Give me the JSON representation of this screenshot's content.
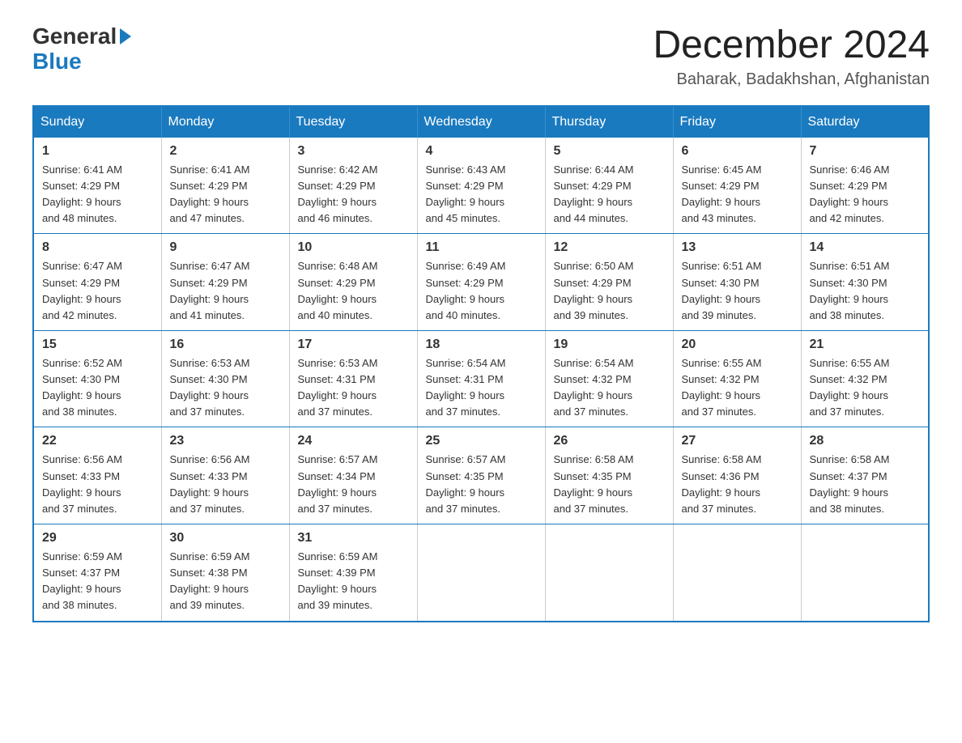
{
  "logo": {
    "general": "General",
    "blue": "Blue",
    "arrow": "▶"
  },
  "title": {
    "month_year": "December 2024",
    "location": "Baharak, Badakhshan, Afghanistan"
  },
  "days_of_week": [
    "Sunday",
    "Monday",
    "Tuesday",
    "Wednesday",
    "Thursday",
    "Friday",
    "Saturday"
  ],
  "weeks": [
    [
      {
        "day": "1",
        "sunrise": "6:41 AM",
        "sunset": "4:29 PM",
        "daylight": "9 hours and 48 minutes."
      },
      {
        "day": "2",
        "sunrise": "6:41 AM",
        "sunset": "4:29 PM",
        "daylight": "9 hours and 47 minutes."
      },
      {
        "day": "3",
        "sunrise": "6:42 AM",
        "sunset": "4:29 PM",
        "daylight": "9 hours and 46 minutes."
      },
      {
        "day": "4",
        "sunrise": "6:43 AM",
        "sunset": "4:29 PM",
        "daylight": "9 hours and 45 minutes."
      },
      {
        "day": "5",
        "sunrise": "6:44 AM",
        "sunset": "4:29 PM",
        "daylight": "9 hours and 44 minutes."
      },
      {
        "day": "6",
        "sunrise": "6:45 AM",
        "sunset": "4:29 PM",
        "daylight": "9 hours and 43 minutes."
      },
      {
        "day": "7",
        "sunrise": "6:46 AM",
        "sunset": "4:29 PM",
        "daylight": "9 hours and 42 minutes."
      }
    ],
    [
      {
        "day": "8",
        "sunrise": "6:47 AM",
        "sunset": "4:29 PM",
        "daylight": "9 hours and 42 minutes."
      },
      {
        "day": "9",
        "sunrise": "6:47 AM",
        "sunset": "4:29 PM",
        "daylight": "9 hours and 41 minutes."
      },
      {
        "day": "10",
        "sunrise": "6:48 AM",
        "sunset": "4:29 PM",
        "daylight": "9 hours and 40 minutes."
      },
      {
        "day": "11",
        "sunrise": "6:49 AM",
        "sunset": "4:29 PM",
        "daylight": "9 hours and 40 minutes."
      },
      {
        "day": "12",
        "sunrise": "6:50 AM",
        "sunset": "4:29 PM",
        "daylight": "9 hours and 39 minutes."
      },
      {
        "day": "13",
        "sunrise": "6:51 AM",
        "sunset": "4:30 PM",
        "daylight": "9 hours and 39 minutes."
      },
      {
        "day": "14",
        "sunrise": "6:51 AM",
        "sunset": "4:30 PM",
        "daylight": "9 hours and 38 minutes."
      }
    ],
    [
      {
        "day": "15",
        "sunrise": "6:52 AM",
        "sunset": "4:30 PM",
        "daylight": "9 hours and 38 minutes."
      },
      {
        "day": "16",
        "sunrise": "6:53 AM",
        "sunset": "4:30 PM",
        "daylight": "9 hours and 37 minutes."
      },
      {
        "day": "17",
        "sunrise": "6:53 AM",
        "sunset": "4:31 PM",
        "daylight": "9 hours and 37 minutes."
      },
      {
        "day": "18",
        "sunrise": "6:54 AM",
        "sunset": "4:31 PM",
        "daylight": "9 hours and 37 minutes."
      },
      {
        "day": "19",
        "sunrise": "6:54 AM",
        "sunset": "4:32 PM",
        "daylight": "9 hours and 37 minutes."
      },
      {
        "day": "20",
        "sunrise": "6:55 AM",
        "sunset": "4:32 PM",
        "daylight": "9 hours and 37 minutes."
      },
      {
        "day": "21",
        "sunrise": "6:55 AM",
        "sunset": "4:32 PM",
        "daylight": "9 hours and 37 minutes."
      }
    ],
    [
      {
        "day": "22",
        "sunrise": "6:56 AM",
        "sunset": "4:33 PM",
        "daylight": "9 hours and 37 minutes."
      },
      {
        "day": "23",
        "sunrise": "6:56 AM",
        "sunset": "4:33 PM",
        "daylight": "9 hours and 37 minutes."
      },
      {
        "day": "24",
        "sunrise": "6:57 AM",
        "sunset": "4:34 PM",
        "daylight": "9 hours and 37 minutes."
      },
      {
        "day": "25",
        "sunrise": "6:57 AM",
        "sunset": "4:35 PM",
        "daylight": "9 hours and 37 minutes."
      },
      {
        "day": "26",
        "sunrise": "6:58 AM",
        "sunset": "4:35 PM",
        "daylight": "9 hours and 37 minutes."
      },
      {
        "day": "27",
        "sunrise": "6:58 AM",
        "sunset": "4:36 PM",
        "daylight": "9 hours and 37 minutes."
      },
      {
        "day": "28",
        "sunrise": "6:58 AM",
        "sunset": "4:37 PM",
        "daylight": "9 hours and 38 minutes."
      }
    ],
    [
      {
        "day": "29",
        "sunrise": "6:59 AM",
        "sunset": "4:37 PM",
        "daylight": "9 hours and 38 minutes."
      },
      {
        "day": "30",
        "sunrise": "6:59 AM",
        "sunset": "4:38 PM",
        "daylight": "9 hours and 39 minutes."
      },
      {
        "day": "31",
        "sunrise": "6:59 AM",
        "sunset": "4:39 PM",
        "daylight": "9 hours and 39 minutes."
      },
      null,
      null,
      null,
      null
    ]
  ],
  "labels": {
    "sunrise": "Sunrise:",
    "sunset": "Sunset:",
    "daylight": "Daylight:"
  }
}
